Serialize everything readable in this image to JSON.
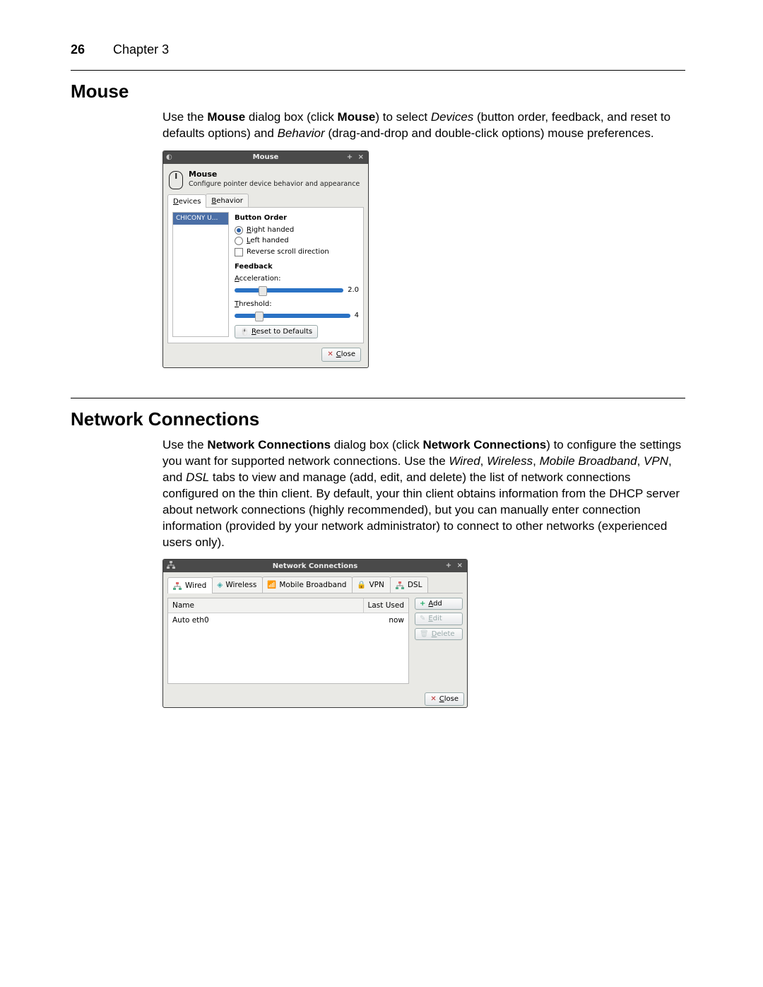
{
  "page": {
    "number": "26",
    "chapter": "Chapter 3"
  },
  "section1": {
    "heading": "Mouse",
    "para_parts": {
      "a": "Use the ",
      "b": "Mouse",
      "c": " dialog box (click ",
      "d": "Mouse",
      "e": ") to select ",
      "f": "Devices",
      "g": " (button order, feedback, and reset to defaults options) and ",
      "h": "Behavior",
      "i": " (drag-and-drop and double-click options) mouse preferences."
    }
  },
  "mouse_dialog": {
    "title": "Mouse",
    "header_title": "Mouse",
    "header_sub": "Configure pointer device behavior and appearance",
    "tabs": {
      "devices": "Devices",
      "behavior": "Behavior"
    },
    "device_item": "CHICONY U...",
    "group_button_order": "Button Order",
    "opt_right": "Right handed",
    "opt_left": "Left handed",
    "opt_reverse": "Reverse scroll direction",
    "group_feedback": "Feedback",
    "lbl_accel": "Acceleration:",
    "val_accel": "2.0",
    "lbl_thresh": "Threshold:",
    "val_thresh": "4",
    "btn_reset": "Reset to Defaults",
    "btn_close": "Close"
  },
  "section2": {
    "heading": "Network Connections",
    "para_parts": {
      "a": "Use the ",
      "b": "Network Connections",
      "c": " dialog box (click ",
      "d": "Network Connections",
      "e": ") to configure the settings you want for supported network connections. Use the ",
      "f": "Wired",
      "g": ", ",
      "h": "Wireless",
      "i": ", ",
      "j": "Mobile Broadband",
      "k": ", ",
      "l": "VPN",
      "m": ", and ",
      "n": "DSL",
      "o": " tabs to view and manage (add, edit, and delete) the list of network connections configured on the thin client. By default, your thin client obtains information from the DHCP server about network connections (highly recommended), but you can manually enter connection information (provided by your network administrator) to connect to other networks (experienced users only)."
    }
  },
  "net_dialog": {
    "title": "Network Connections",
    "tabs": {
      "wired": "Wired",
      "wireless": "Wireless",
      "mobile": "Mobile Broadband",
      "vpn": "VPN",
      "dsl": "DSL"
    },
    "col_name": "Name",
    "col_last": "Last Used",
    "row_name": "Auto eth0",
    "row_last": "now",
    "btn_add": "Add",
    "btn_edit": "Edit",
    "btn_delete": "Delete",
    "btn_close": "Close"
  }
}
